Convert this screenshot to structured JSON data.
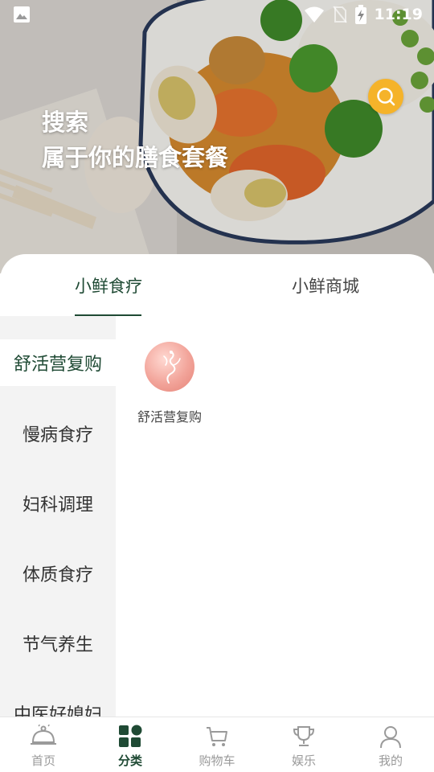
{
  "status_bar": {
    "time": "11:19"
  },
  "hero": {
    "title_line1": "搜索",
    "title_line2": "属于你的膳食套餐"
  },
  "tabs": [
    {
      "label": "小鲜食疗",
      "active": true
    },
    {
      "label": "小鲜商城",
      "active": false
    }
  ],
  "sidebar": {
    "items": [
      {
        "label": "舒活营复购",
        "active": true
      },
      {
        "label": "慢病食疗",
        "active": false
      },
      {
        "label": "妇科调理",
        "active": false
      },
      {
        "label": "体质食疗",
        "active": false
      },
      {
        "label": "节气养生",
        "active": false
      },
      {
        "label": "中医好媳妇",
        "active": false
      }
    ]
  },
  "content": {
    "categories": [
      {
        "label": "舒活营复购"
      }
    ]
  },
  "bottom_nav": {
    "items": [
      {
        "label": "首页",
        "icon": "dish-cover-icon",
        "active": false
      },
      {
        "label": "分类",
        "icon": "grid-category-icon",
        "active": true
      },
      {
        "label": "购物车",
        "icon": "cart-icon",
        "active": false
      },
      {
        "label": "娱乐",
        "icon": "trophy-icon",
        "active": false
      },
      {
        "label": "我的",
        "icon": "user-icon",
        "active": false
      }
    ]
  },
  "colors": {
    "accent": "#1f4a34",
    "search_button": "#f5b32a",
    "sidebar_bg": "#f3f3f3",
    "inactive_nav": "#9a9a9a"
  }
}
